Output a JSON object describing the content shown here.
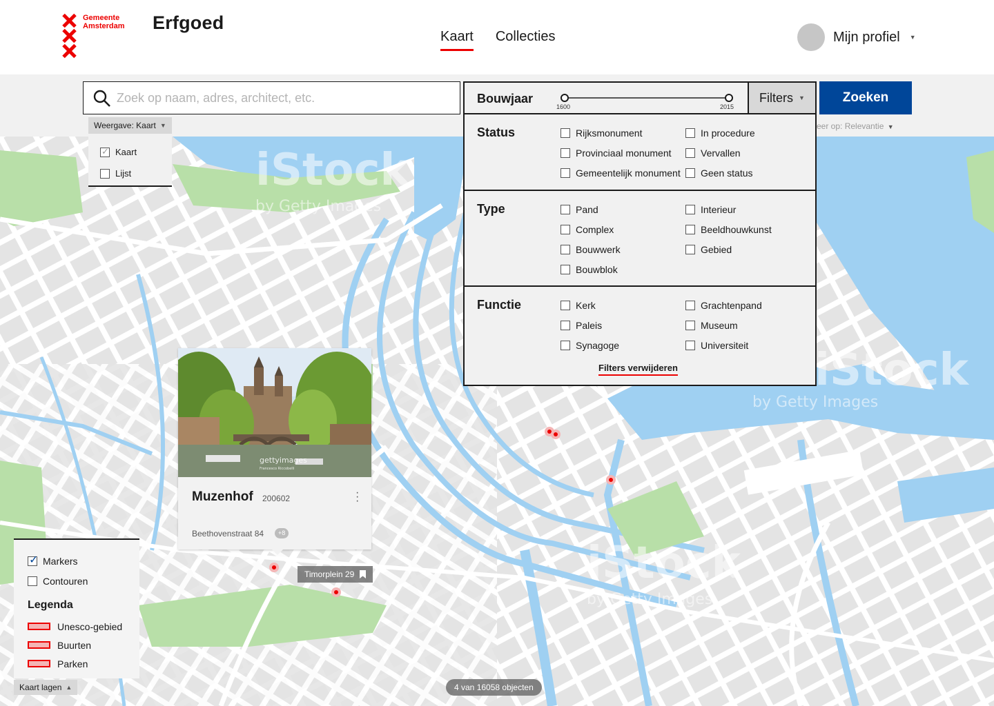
{
  "header": {
    "logo_line1": "Gemeente",
    "logo_line2": "Amsterdam",
    "app_title": "Erfgoed",
    "nav": [
      {
        "label": "Kaart",
        "active": true
      },
      {
        "label": "Collecties",
        "active": false
      }
    ],
    "profile_label": "Mijn profiel"
  },
  "search": {
    "placeholder": "Zoek op naam, adres, architect, etc.",
    "value": "",
    "bouwjaar_label": "Bouwjaar",
    "year_min": "1600",
    "year_max": "2015",
    "filters_label": "Filters",
    "submit_label": "Zoeken",
    "sort_label": "eer op: Relevantie"
  },
  "view": {
    "tag_label": "Weergave: Kaart",
    "options": [
      {
        "label": "Kaart",
        "checked": true
      },
      {
        "label": "Lijst",
        "checked": false
      }
    ]
  },
  "filters": {
    "status": {
      "title": "Status",
      "col1": [
        "Rijksmonument",
        "Provinciaal monument",
        "Gemeentelijk monument"
      ],
      "col2": [
        "In procedure",
        "Vervallen",
        "Geen status"
      ]
    },
    "type": {
      "title": "Type",
      "col1": [
        "Pand",
        "Complex",
        "Bouwwerk",
        "Bouwblok"
      ],
      "col2": [
        "Interieur",
        "Beeldhouwkunst",
        "Gebied"
      ]
    },
    "functie": {
      "title": "Functie",
      "col1": [
        "Kerk",
        "Paleis",
        "Synagoge"
      ],
      "col2": [
        "Grachtenpand",
        "Museum",
        "Universiteit"
      ]
    },
    "clear_label": "Filters verwijderen"
  },
  "card": {
    "title": "Muzenhof",
    "id": "200602",
    "address": "Beethovenstraat 84",
    "badge": "+8",
    "image_watermark": "gettyimages",
    "image_credit": "Francesco Riccobelli"
  },
  "tooltip": {
    "label": "Timorplein 29"
  },
  "layers": {
    "options": [
      {
        "label": "Markers",
        "checked": true
      },
      {
        "label": "Contouren",
        "checked": false
      }
    ],
    "legend_title": "Legenda",
    "legend": [
      "Unesco-gebied",
      "Buurten",
      "Parken"
    ],
    "toggle_label": "Kaart lagen"
  },
  "map": {
    "watermark_title": "iStock",
    "watermark_sub": "by Getty Images"
  },
  "results": {
    "count_label": "4 van 16058 objecten"
  },
  "colors": {
    "brand_red": "#ec0000",
    "primary_blue": "#004699",
    "water": "#9fd0f2",
    "park": "#b8dfa8"
  }
}
